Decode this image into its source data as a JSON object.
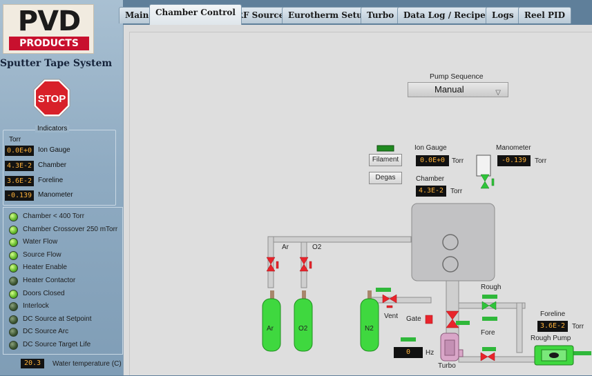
{
  "app": {
    "logo_text": "PVD",
    "logo_subtext": "PRODUCTS",
    "system_title": "Sputter Tape System",
    "stop_label": "STOP"
  },
  "tabs": [
    {
      "label": "Main"
    },
    {
      "label": "Chamber Control",
      "active": true
    },
    {
      "label": "RF Source"
    },
    {
      "label": "Eurotherm Setup"
    },
    {
      "label": "Turbo"
    },
    {
      "label": "Data Log / Recipes"
    },
    {
      "label": "Logs"
    },
    {
      "label": "Reel PID"
    }
  ],
  "indicators": {
    "title": "Indicators",
    "unit": "Torr",
    "rows": [
      {
        "value": "0.0E+0",
        "label": "Ion Gauge"
      },
      {
        "value": "4.3E-2",
        "label": "Chamber"
      },
      {
        "value": "3.6E-2",
        "label": "Foreline"
      },
      {
        "value": "-0.139",
        "label": "Manometer"
      }
    ]
  },
  "status_leds": [
    {
      "label": "Chamber < 400 Torr",
      "state": "on"
    },
    {
      "label": "Chamber Crossover 250 mTorr",
      "state": "on"
    },
    {
      "label": "Water Flow",
      "state": "on"
    },
    {
      "label": "Source Flow",
      "state": "on"
    },
    {
      "label": "Heater Enable",
      "state": "on"
    },
    {
      "label": "Heater Contactor",
      "state": "off"
    },
    {
      "label": "Doors Closed",
      "state": "on"
    },
    {
      "label": "Interlock",
      "state": "off"
    },
    {
      "label": "DC Source at Setpoint",
      "state": "off"
    },
    {
      "label": "DC Source Arc",
      "state": "off"
    },
    {
      "label": "DC Source Target Life",
      "state": "off"
    }
  ],
  "water_temp": {
    "value": "20.3",
    "label": "Water temperature (C)"
  },
  "pump_sequence": {
    "label": "Pump Sequence",
    "value": "Manual"
  },
  "gauges": {
    "ion_gauge": {
      "label": "Ion Gauge",
      "value": "0.0E+0",
      "unit": "Torr"
    },
    "manometer": {
      "label": "Manometer",
      "value": "-0.139",
      "unit": "Torr"
    },
    "chamber": {
      "label": "Chamber",
      "value": "4.3E-2",
      "unit": "Torr"
    },
    "foreline": {
      "label": "Foreline",
      "value": "3.6E-2",
      "unit": "Torr"
    },
    "turbo_speed": {
      "value": "0",
      "unit": "Hz"
    }
  },
  "buttons": {
    "filament": "Filament",
    "degas": "Degas"
  },
  "diagram_labels": {
    "ar": "Ar",
    "o2": "O2",
    "n2": "N2",
    "vent": "Vent",
    "gate": "Gate",
    "turbo": "Turbo",
    "rough": "Rough",
    "fore": "Fore",
    "rough_pump": "Rough Pump"
  },
  "colors": {
    "valve_closed": "#e8242c",
    "valve_open": "#2fc43a",
    "cylinder": "#3fd83f",
    "readout_text": "#ffb23a"
  }
}
